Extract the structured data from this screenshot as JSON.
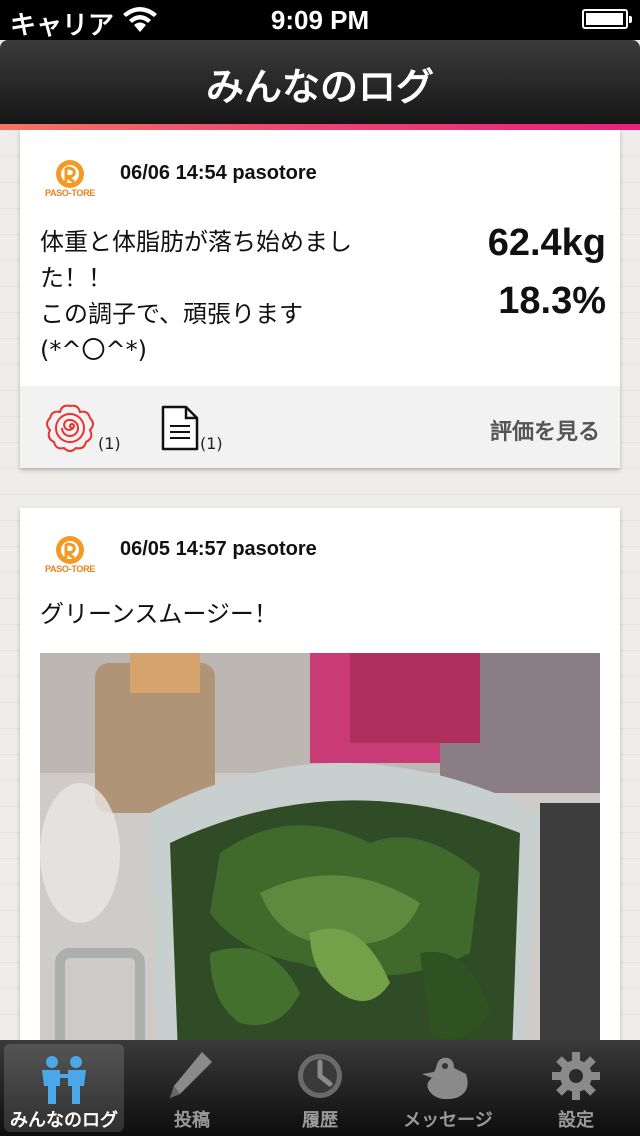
{
  "status_bar": {
    "carrier": "キャリア",
    "time": "9:09 PM"
  },
  "nav": {
    "title": "みんなのログ"
  },
  "posts": [
    {
      "logo_text": "PASO-TORE",
      "meta": "06/06 14:54 pasotore",
      "text": "体重と体脂肪が落ち始めまし\nた！！\nこの調子で、頑張ります\n(*^〇^*)",
      "weight": "62.4kg",
      "fat": "18.3%",
      "flower_count": "(1)",
      "comment_count": "(1)",
      "see_rating": "評価を見る",
      "icons": {
        "reaction": "flower-icon",
        "comment": "document-icon"
      },
      "accent_color": "#e8332f"
    },
    {
      "logo_text": "PASO-TORE",
      "meta": "06/05 14:57 pasotore",
      "text": "グリーンスムージー！"
    }
  ],
  "tabs": [
    {
      "label": "みんなのログ",
      "icon": "people-icon",
      "active": true
    },
    {
      "label": "投稿",
      "icon": "pencil-icon"
    },
    {
      "label": "履歴",
      "icon": "clock-icon"
    },
    {
      "label": "メッセージ",
      "icon": "bird-icon"
    },
    {
      "label": "設定",
      "icon": "gear-icon"
    }
  ],
  "colors": {
    "accent_gradient_start": "#f37560",
    "accent_gradient_end": "#ea1f7d",
    "logo_orange": "#e6821e",
    "active_tab_icon": "#4aa8e8"
  }
}
